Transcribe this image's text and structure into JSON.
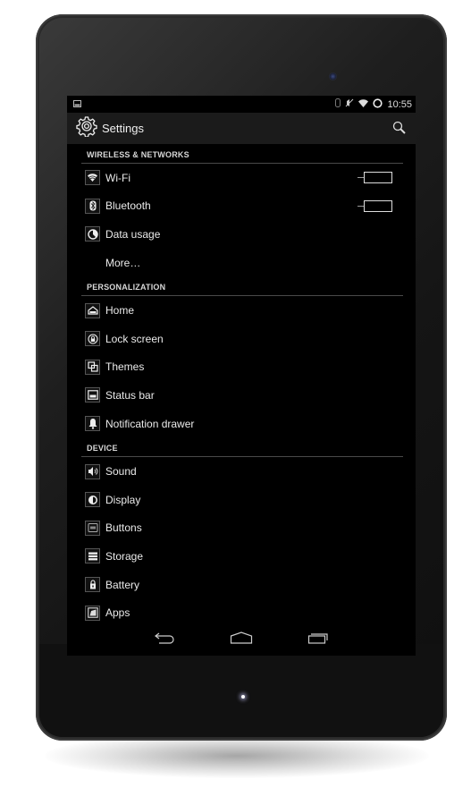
{
  "status_bar": {
    "left_icon": "image-notification-icon",
    "icons": [
      "bluetooth-icon",
      "mute-icon",
      "wifi-icon",
      "sync-circle-icon"
    ],
    "time": "10:55"
  },
  "action_bar": {
    "icon": "settings-gear-icon",
    "title": "Settings",
    "search_icon": "search-icon"
  },
  "sections": [
    {
      "header": "WIRELESS & NETWORKS",
      "items": [
        {
          "label": "Wi-Fi",
          "icon": "wifi-icon",
          "toggle": "off"
        },
        {
          "label": "Bluetooth",
          "icon": "bluetooth-icon",
          "toggle": "off"
        },
        {
          "label": "Data usage",
          "icon": "data-usage-icon"
        },
        {
          "label": "More…",
          "icon": ""
        }
      ]
    },
    {
      "header": "PERSONALIZATION",
      "items": [
        {
          "label": "Home",
          "icon": "home-icon"
        },
        {
          "label": "Lock screen",
          "icon": "lock-screen-icon"
        },
        {
          "label": "Themes",
          "icon": "themes-icon"
        },
        {
          "label": "Status bar",
          "icon": "status-bar-icon"
        },
        {
          "label": "Notification drawer",
          "icon": "bell-icon"
        }
      ]
    },
    {
      "header": "DEVICE",
      "items": [
        {
          "label": "Sound",
          "icon": "sound-icon"
        },
        {
          "label": "Display",
          "icon": "display-icon"
        },
        {
          "label": "Buttons",
          "icon": "buttons-icon"
        },
        {
          "label": "Storage",
          "icon": "storage-icon"
        },
        {
          "label": "Battery",
          "icon": "battery-icon"
        },
        {
          "label": "Apps",
          "icon": "apps-icon"
        }
      ]
    }
  ],
  "nav_bar": [
    "back-icon",
    "home-nav-icon",
    "recents-icon"
  ]
}
